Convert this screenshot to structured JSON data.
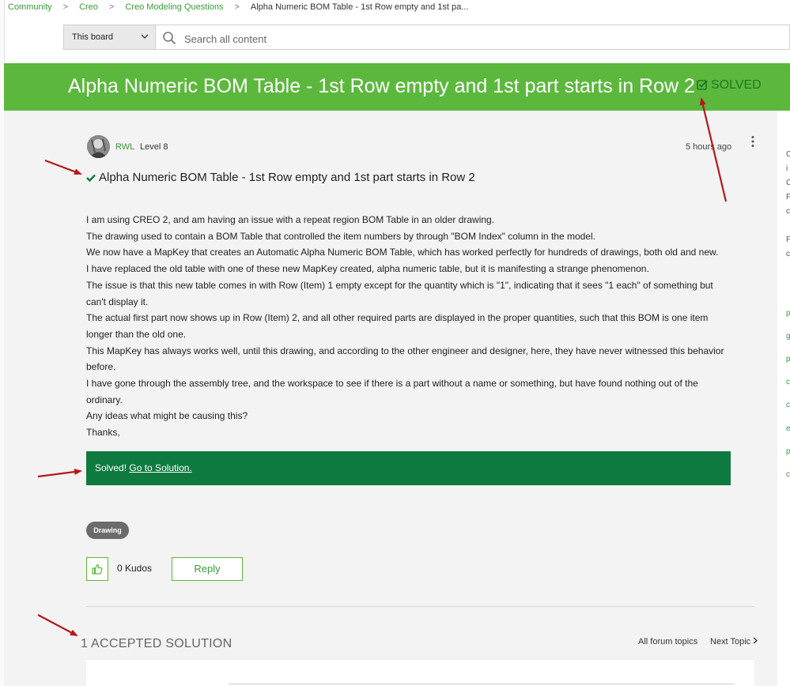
{
  "breadcrumb": [
    "Community",
    "Creo",
    "Creo Modeling Questions",
    "Alpha Numeric BOM Table - 1st Row empty and 1st pa..."
  ],
  "search": {
    "scope_label": "This board",
    "placeholder": "Search all content"
  },
  "banner": {
    "title": "Alpha Numeric BOM Table - 1st Row empty and 1st part starts in Row 2",
    "status": "SOLVED"
  },
  "post": {
    "author": "RWL",
    "level": "Level 8",
    "time": "5 hours ago",
    "title": "Alpha Numeric BOM Table - 1st Row empty and 1st part starts in Row 2",
    "body": [
      "I am using CREO 2, and am having an issue with a repeat region BOM Table in an older drawing.",
      "The drawing used to contain a BOM Table that controlled the item numbers by through \"BOM Index\" column in the model.",
      "We now have a MapKey that creates an Automatic Alpha Numeric BOM Table, which has worked perfectly for hundreds of drawings, both old and new.",
      "I have replaced the old table with one of these new MapKey created, alpha numeric table, but it is manifesting a strange phenomenon.",
      "The issue is that this new table comes in with Row (Item) 1 empty except for the quantity which is \"1\", indicating that it sees \"1 each\" of something but can't display it.",
      "The actual first part now shows up in Row (Item) 2, and all other required parts are displayed in the proper quantities, such that this BOM is one item longer than the old one.",
      "This MapKey has always works well, until this drawing, and according to the other engineer and designer, here, they have never witnessed this behavior before.",
      "I have gone through the assembly tree, and the workspace to see if there is a part without a name or something, but have found nothing out of the ordinary.",
      "Any ideas what might be causing this?",
      "Thanks,"
    ],
    "solved_text": "Solved!",
    "solved_link": "Go to Solution.",
    "tag": "Drawing",
    "kudos": "0 Kudos",
    "reply_label": "Reply"
  },
  "accepted": {
    "heading": "1 ACCEPTED SOLUTION",
    "all_topics": "All forum topics",
    "next_topic": "Next Topic"
  },
  "colors": {
    "brand_green": "#5cb83d",
    "solved_bar": "#0e7a3f",
    "link_green": "#3a9a3a",
    "annotation_arrow": "#b3191c"
  }
}
